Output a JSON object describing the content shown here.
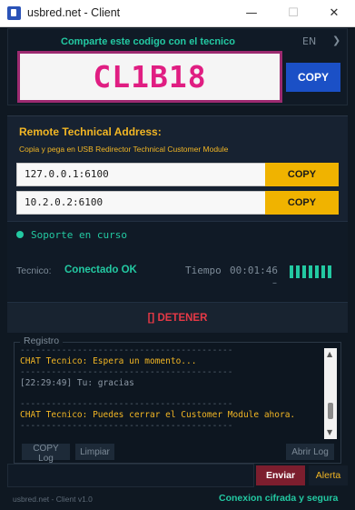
{
  "window": {
    "title": "usbred.net - Client",
    "minimize": "—",
    "maximize": "☐",
    "close": "✕"
  },
  "share": {
    "heading": "Comparte este codigo con el tecnico",
    "language": "EN",
    "language_arrow": "❯",
    "code": "CL1B18",
    "copy_label": "COPY"
  },
  "remote": {
    "title": "Remote Technical Address:",
    "hint": "Copia y pega en USB Redirector Technical Customer Module",
    "addresses": [
      {
        "value": "127.0.0.1:6100",
        "copy_label": "COPY"
      },
      {
        "value": "10.2.0.2:6100",
        "copy_label": "COPY"
      }
    ]
  },
  "status": {
    "text": "Soporte en curso",
    "tecnico_label": "Tecnico:",
    "tecnico_value": "Conectado OK",
    "tiempo_label": "Tiempo",
    "tiempo_value": "00:01:46",
    "tiempo_dash": "–",
    "signal_levels": [
      0.8,
      0.8,
      0.8,
      0.8,
      0.8,
      0.8,
      0.8
    ],
    "accent_color": "#23c9a2"
  },
  "stop": {
    "label": "[] DETENER",
    "color": "#e63946"
  },
  "log": {
    "legend": "Registro",
    "lines": [
      {
        "kind": "sep",
        "text": "-----------------------------------------"
      },
      {
        "kind": "chat",
        "text": "CHAT Tecnico: Espera un momento..."
      },
      {
        "kind": "sep",
        "text": "-----------------------------------------"
      },
      {
        "kind": "info",
        "text": "[22:29:49] Tu: gracias"
      },
      {
        "kind": "blank",
        "text": ""
      },
      {
        "kind": "sep",
        "text": "-----------------------------------------"
      },
      {
        "kind": "chat",
        "text": "CHAT Tecnico: Puedes cerrar el Customer Module ahora."
      },
      {
        "kind": "sep",
        "text": "-----------------------------------------"
      }
    ],
    "scroll_up": "▲",
    "scroll_down": "▼",
    "copy_log": "COPY Log",
    "clear": "Limpiar",
    "open_log": "Abrir Log"
  },
  "chat": {
    "input_value": "",
    "send": "Enviar",
    "alert": "Alerta"
  },
  "footer": {
    "version": "usbred.net - Client v1.0",
    "secure": "Conexion cifrada y segura"
  }
}
